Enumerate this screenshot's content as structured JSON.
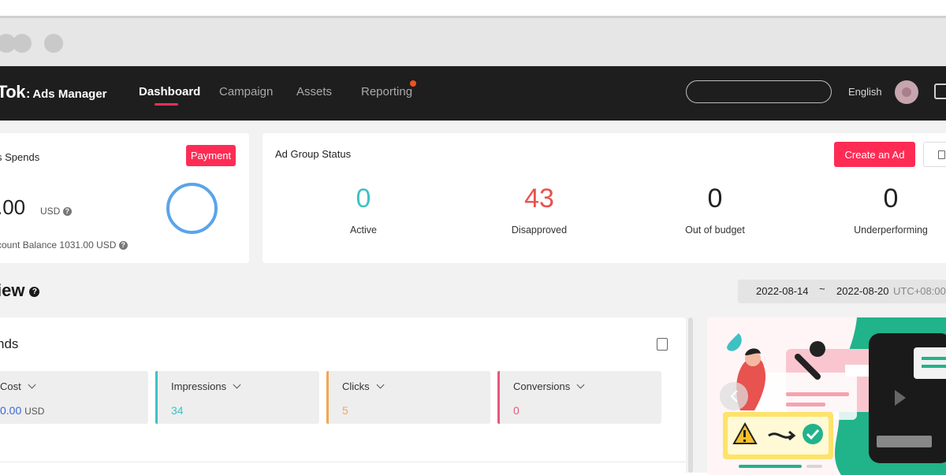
{
  "navbar": {
    "brand_main": "Tok",
    "brand_colon": ":",
    "brand_sub": "Ads Manager",
    "items": [
      {
        "label": "Dashboard",
        "active": true
      },
      {
        "label": "Campaign",
        "active": false
      },
      {
        "label": "Assets",
        "active": false
      },
      {
        "label": "Reporting",
        "active": false,
        "notification_dot": true
      }
    ],
    "search_placeholder": "",
    "language": "English"
  },
  "spends_card": {
    "title": "s Spends",
    "payment_label": "Payment",
    "amount": ".00",
    "currency": "USD",
    "balance_text": "count Balance 1031.00 USD"
  },
  "status_card": {
    "title": "Ad Group Status",
    "create_label": "Create an Ad",
    "stats": [
      {
        "value": "0",
        "label": "Active",
        "color": "#3fc1c3"
      },
      {
        "value": "43",
        "label": "Disapproved",
        "color": "#e8524f"
      },
      {
        "value": "0",
        "label": "Out of budget",
        "color": "#222222"
      },
      {
        "value": "0",
        "label": "Underperforming",
        "color": "#222222"
      }
    ]
  },
  "overview": {
    "title": "iew",
    "date_start": "2022-08-14",
    "date_sep": "~",
    "date_end": "2022-08-20",
    "timezone": "UTC+08:00"
  },
  "trends_card": {
    "title": "nds",
    "metrics": [
      {
        "label": "Cost",
        "value": "0.00",
        "unit": "USD",
        "color": "#3a66d6"
      },
      {
        "label": "Impressions",
        "value": "34",
        "color": "#3fc1c3"
      },
      {
        "label": "Clicks",
        "value": "5",
        "color": "#f0a851"
      },
      {
        "label": "Conversions",
        "value": "0",
        "color": "#e8587a"
      }
    ]
  },
  "colors": {
    "accent": "#fe2c55",
    "navbar_bg": "#1e1e1e",
    "page_bg": "#f2f2f2",
    "ring": "#5aa4ea"
  }
}
